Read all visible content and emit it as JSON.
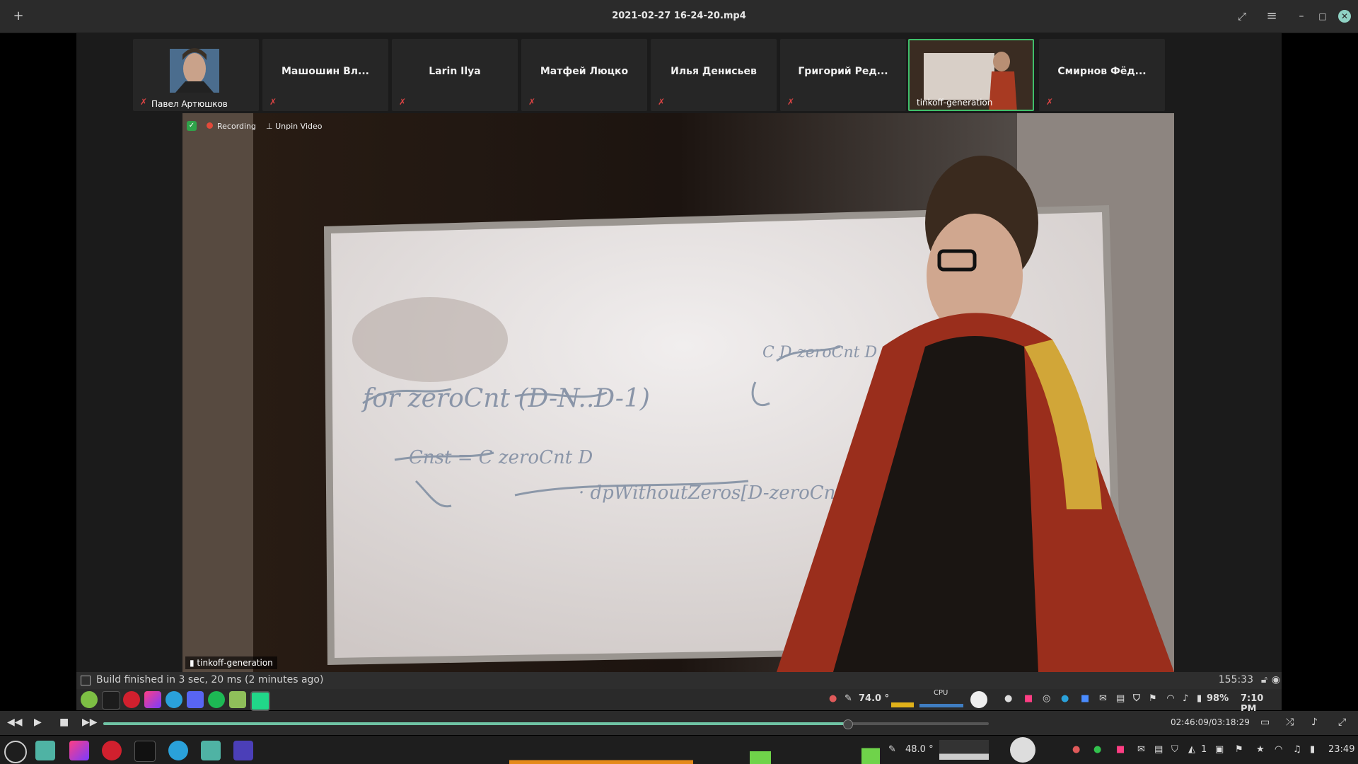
{
  "window": {
    "title": "2021-02-27 16-24-20.mp4",
    "new_tab_icon": "plus-icon",
    "fullscreen_icon": "fullscreen-icon",
    "menu_icon": "hamburger-menu-icon",
    "minimize_icon": "minimize-icon",
    "maximize_icon": "maximize-icon",
    "close_icon": "close-icon"
  },
  "meeting": {
    "participants": [
      {
        "name": "Павел Артюшков",
        "has_video": true,
        "muted": true
      },
      {
        "name": "Машошин Вл...",
        "has_video": false,
        "muted": true
      },
      {
        "name": "Larin Ilya",
        "has_video": false,
        "muted": true
      },
      {
        "name": "Матфей Люцко",
        "has_video": false,
        "muted": true
      },
      {
        "name": "Илья Денисьев",
        "has_video": false,
        "muted": true
      },
      {
        "name": "Григорий Ред...",
        "has_video": false,
        "muted": true
      },
      {
        "name": "tinkoff-generation",
        "has_video": true,
        "muted": false,
        "active": true
      },
      {
        "name": "Смирнов Фёд...",
        "has_video": false,
        "muted": true
      }
    ],
    "recording_label": "Recording",
    "unpin_label": "Unpin Video",
    "speaker_name": "tinkoff-generation",
    "whiteboard_lines": [
      "for zeroCnt (D-N..D-1)",
      "Cnst = C zeroCnt D",
      "· dpWithoutZeros[D-zeroCnt][N]",
      "C D-zeroCnt D"
    ]
  },
  "status_bar": {
    "build_message": "Build finished in 3 sec, 20 ms (2 minutes ago)",
    "position": "155:33"
  },
  "ide_panel": {
    "apps": [
      "mint-menu-icon",
      "terminal-icon",
      "opera-icon",
      "jetbrains-toolbox-icon",
      "telegram-icon",
      "discord-icon",
      "spotify-icon",
      "files-icon",
      "clion-icon"
    ],
    "temp_cpu": "74.0 °",
    "cpu_label": "CPU",
    "battery": "98%",
    "time": "7:10 PM",
    "colors": {
      "spotify": "#1db954",
      "telegram": "#2aa1da",
      "discord": "#5865f2",
      "opera": "#d1202e"
    }
  },
  "player": {
    "current_time": "02:46:09",
    "total_time": "03:18:29",
    "time_display": "02:46:09/03:18:29",
    "progress": 0.84,
    "accent": "#6fc3a4"
  },
  "taskbar": {
    "apps": [
      "mint-menu-icon",
      "files-icon",
      "jetbrains-toolbox-icon",
      "opera-icon",
      "terminal-icon",
      "telegram-icon",
      "files-icon",
      "media-player-icon"
    ],
    "temp": "48.0 °",
    "notifications": "1",
    "clock": "23:49"
  }
}
